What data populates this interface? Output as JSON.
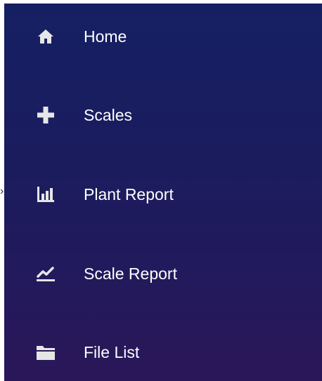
{
  "nav": {
    "items": [
      {
        "label": "Home",
        "icon": "home-icon"
      },
      {
        "label": "Scales",
        "icon": "plus-icon"
      },
      {
        "label": "Plant Report",
        "icon": "bar-chart-icon"
      },
      {
        "label": "Scale Report",
        "icon": "line-chart-icon"
      },
      {
        "label": "File List",
        "icon": "folder-icon"
      }
    ]
  },
  "edge_glyph": "›",
  "colors": {
    "sidebar_top": "#152063",
    "sidebar_bottom": "#2a1759",
    "text": "#ffffff",
    "icon": "#e6e6e6"
  }
}
